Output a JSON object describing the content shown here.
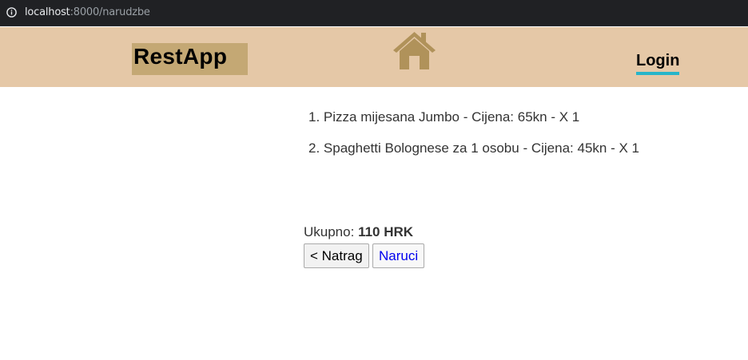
{
  "browser": {
    "url_host": "localhost",
    "url_rest": ":8000/narudzbe"
  },
  "header": {
    "brand": "RestApp",
    "home_icon": "home-icon",
    "login_label": "Login",
    "colors": {
      "header_bg": "#e5c8a7",
      "brand_bg": "#c4a874",
      "login_underline": "#27b5c9",
      "home_icon": "#b0925a"
    }
  },
  "order": {
    "items": [
      {
        "number": "1.",
        "name": "Pizza mijesana Jumbo",
        "price_label": "Cijena:",
        "price": "65kn",
        "qty": "X 1"
      },
      {
        "number": "2.",
        "name": "Spaghetti Bolognese za 1 osobu",
        "price_label": "Cijena:",
        "price": "45kn",
        "qty": "X 1"
      }
    ],
    "total_label": "Ukupno:",
    "total_value": "110 HRK"
  },
  "actions": {
    "back_label": "< Natrag",
    "order_label": "Naruci"
  }
}
